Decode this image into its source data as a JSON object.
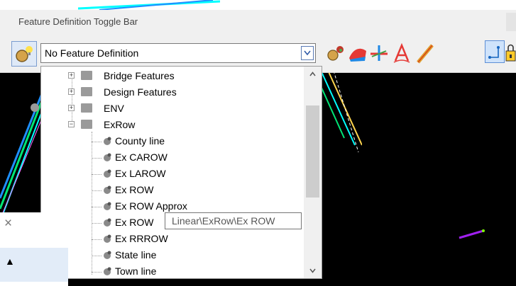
{
  "toggle_bar": {
    "title": "Feature Definition Toggle Bar",
    "combo_value": "No Feature Definition",
    "colors": {
      "window_bg": "#f0f0f0",
      "accent": "#5d8fd6"
    }
  },
  "tree": {
    "folders": [
      {
        "label": "Bridge Features",
        "expanded": false
      },
      {
        "label": "Design Features",
        "expanded": false
      },
      {
        "label": "ENV",
        "expanded": false
      },
      {
        "label": "ExRow",
        "expanded": true
      }
    ],
    "children": [
      {
        "label": "County line"
      },
      {
        "label": "Ex CAROW"
      },
      {
        "label": "Ex LAROW"
      },
      {
        "label": "Ex ROW"
      },
      {
        "label": "Ex ROW Approx"
      },
      {
        "label": "Ex ROW"
      },
      {
        "label": "Ex RRROW"
      },
      {
        "label": "State line"
      },
      {
        "label": "Town line"
      }
    ]
  },
  "tooltip": {
    "text": "Linear\\ExRow\\Ex ROW"
  },
  "toolbar_icons": [
    "feature-lock-icon",
    "terrain-icon",
    "corridor-icon",
    "text-icon",
    "linear-template-icon",
    "active-snap-icon",
    "lock-icon"
  ],
  "side_window": {
    "close_glyph": "×",
    "up_glyph": "▲"
  }
}
